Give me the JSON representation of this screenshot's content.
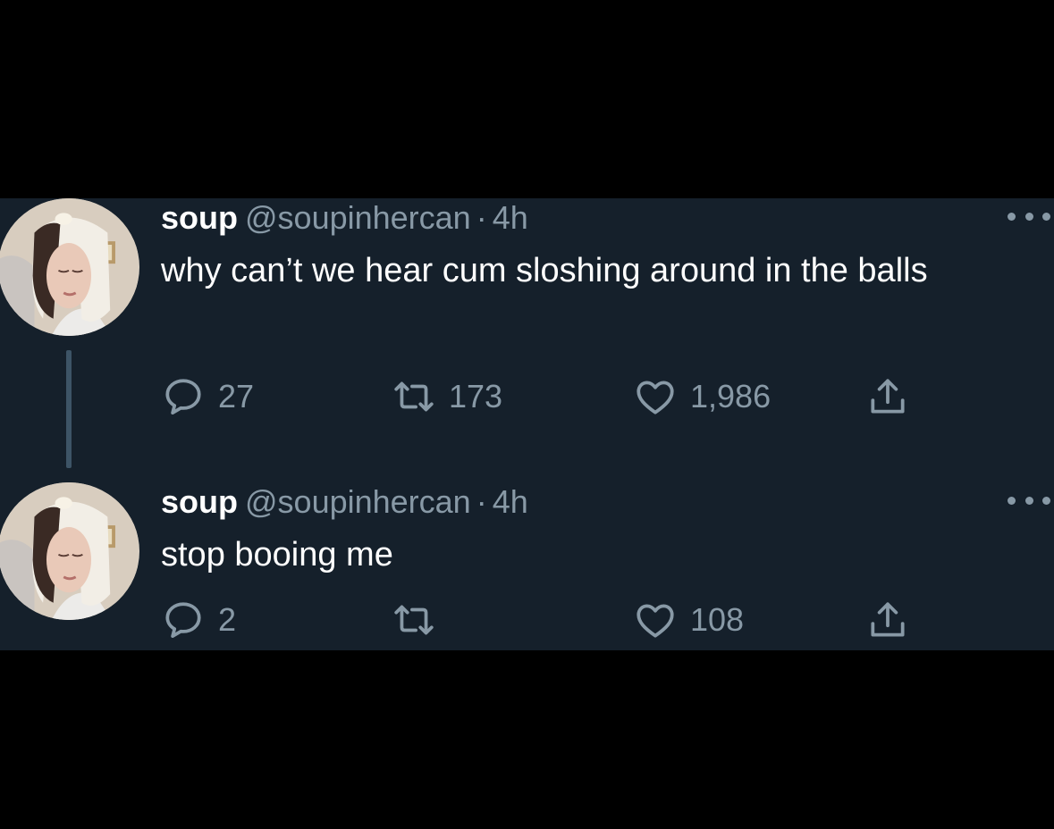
{
  "colors": {
    "page_background": "#000000",
    "timeline_background": "#15202b",
    "text_primary": "#ffffff",
    "text_secondary": "#8899a6",
    "thread_line": "#3d5466"
  },
  "tweets": [
    {
      "display_name": "soup",
      "handle": "@soupinhercan",
      "separator": "·",
      "time": "4h",
      "text": "why can’t we hear cum sloshing around in the balls",
      "replies": "27",
      "retweets": "173",
      "likes": "1,986",
      "icons": [
        "avatar",
        "more-icon",
        "reply-icon",
        "retweet-icon",
        "like-icon",
        "share-icon"
      ]
    },
    {
      "display_name": "soup",
      "handle": "@soupinhercan",
      "separator": "·",
      "time": "4h",
      "text": "stop booing me",
      "replies": "2",
      "retweets": "",
      "likes": "108",
      "icons": [
        "avatar",
        "more-icon",
        "reply-icon",
        "retweet-icon",
        "like-icon",
        "share-icon"
      ]
    }
  ]
}
